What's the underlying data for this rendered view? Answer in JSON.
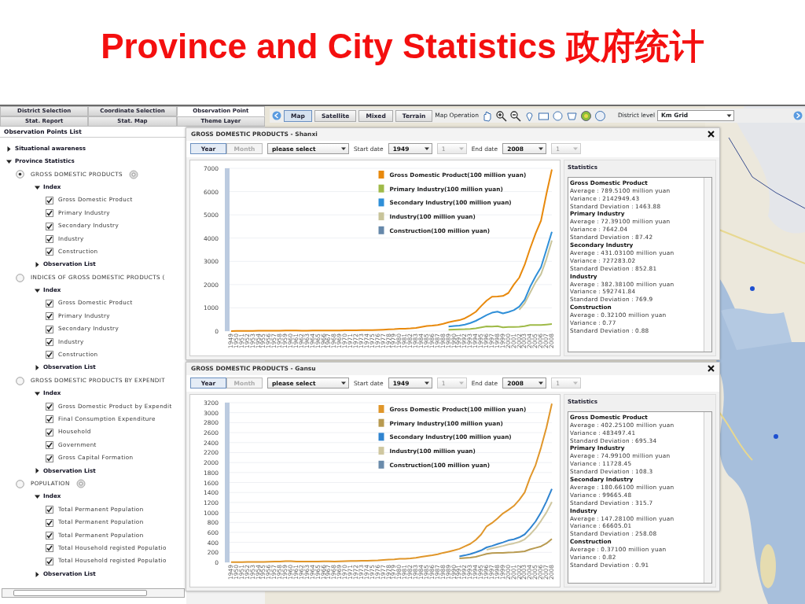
{
  "title": "Province and City Statistics 政府统计",
  "left_tabs": [
    [
      {
        "label": "District Selection",
        "selected": false
      },
      {
        "label": "Coordinate Selection",
        "selected": false
      },
      {
        "label": "Observation Point",
        "selected": true
      }
    ],
    [
      {
        "label": "Stat. Report",
        "selected": false
      },
      {
        "label": "Stat. Map",
        "selected": false
      },
      {
        "label": "Theme Layer",
        "selected": false
      }
    ]
  ],
  "list_title": "Observation Points List",
  "tree": [
    {
      "kind": "folder",
      "label": "Situational awareness",
      "expanded": false
    },
    {
      "kind": "folder",
      "label": "Province Statistics",
      "expanded": true,
      "children": [
        {
          "kind": "radio",
          "label": "GROSS DOMESTIC PRODUCTS",
          "selected": true,
          "has_settings": true,
          "children": [
            {
              "kind": "folder",
              "label": "Index",
              "expanded": true,
              "children": [
                {
                  "kind": "checkbox",
                  "label": "Gross Domestic Product",
                  "checked": true
                },
                {
                  "kind": "checkbox",
                  "label": "Primary Industry",
                  "checked": true
                },
                {
                  "kind": "checkbox",
                  "label": "Secondary Industry",
                  "checked": true
                },
                {
                  "kind": "checkbox",
                  "label": "Industry",
                  "checked": true
                },
                {
                  "kind": "checkbox",
                  "label": "Construction",
                  "checked": true
                }
              ]
            },
            {
              "kind": "folder",
              "label": "Observation List",
              "expanded": false
            }
          ]
        },
        {
          "kind": "radio",
          "label": "INDICES OF GROSS DOMESTIC PRODUCTS (",
          "selected": false,
          "has_settings": false,
          "children": [
            {
              "kind": "folder",
              "label": "Index",
              "expanded": true,
              "children": [
                {
                  "kind": "checkbox",
                  "label": "Gross Domestic Product",
                  "checked": true
                },
                {
                  "kind": "checkbox",
                  "label": "Primary Industry",
                  "checked": true
                },
                {
                  "kind": "checkbox",
                  "label": "Secondary Industry",
                  "checked": true
                },
                {
                  "kind": "checkbox",
                  "label": "Industry",
                  "checked": true
                },
                {
                  "kind": "checkbox",
                  "label": "Construction",
                  "checked": true
                }
              ]
            },
            {
              "kind": "folder",
              "label": "Observation List",
              "expanded": false
            }
          ]
        },
        {
          "kind": "radio",
          "label": "GROSS DOMESTIC PRODUCTS BY EXPENDIT",
          "selected": false,
          "has_settings": false,
          "children": [
            {
              "kind": "folder",
              "label": "Index",
              "expanded": true,
              "children": [
                {
                  "kind": "checkbox",
                  "label": "Gross Domestic Product by Expendit",
                  "checked": true
                },
                {
                  "kind": "checkbox",
                  "label": "Final Consumption Expenditure",
                  "checked": true
                },
                {
                  "kind": "checkbox",
                  "label": "Household",
                  "checked": true
                },
                {
                  "kind": "checkbox",
                  "label": "Government",
                  "checked": true
                },
                {
                  "kind": "checkbox",
                  "label": "Gross Capital Formation",
                  "checked": true
                }
              ]
            },
            {
              "kind": "folder",
              "label": "Observation List",
              "expanded": false
            }
          ]
        },
        {
          "kind": "radio",
          "label": "POPULATION",
          "selected": false,
          "has_settings": true,
          "children": [
            {
              "kind": "folder",
              "label": "Index",
              "expanded": true,
              "children": [
                {
                  "kind": "checkbox",
                  "label": "Total Permanent Population",
                  "checked": true
                },
                {
                  "kind": "checkbox",
                  "label": "Total Permanent Population",
                  "checked": true
                },
                {
                  "kind": "checkbox",
                  "label": "Total Permanent Population",
                  "checked": true
                },
                {
                  "kind": "checkbox",
                  "label": "Total Household registed Populatio",
                  "checked": true
                },
                {
                  "kind": "checkbox",
                  "label": "Total Household registed Populatio",
                  "checked": true
                }
              ]
            },
            {
              "kind": "folder",
              "label": "Observation List",
              "expanded": false
            }
          ]
        }
      ]
    }
  ],
  "map_toolbar": {
    "map_types": [
      {
        "label": "Map",
        "selected": true
      },
      {
        "label": "Satellite",
        "selected": false
      },
      {
        "label": "Mixed",
        "selected": false
      },
      {
        "label": "Terrain",
        "selected": false
      }
    ],
    "operation_label": "Map Operation",
    "district_label": "District level",
    "district_value": "Km Grid"
  },
  "chart_windows": [
    {
      "title": "GROSS DOMESTIC PRODUCTS - Shanxi",
      "modes": [
        {
          "label": "Year",
          "selected": true
        },
        {
          "label": "Month",
          "selected": false
        }
      ],
      "category_select": "please select",
      "start_label": "Start date",
      "start_year": "1949",
      "start_month": {
        "value": "1",
        "disabled": true
      },
      "end_label": "End date",
      "end_year": "2008",
      "end_month": {
        "value": "1",
        "disabled": true
      },
      "chart_data": {
        "type": "line",
        "categories": [
          "1949",
          "1950",
          "1951",
          "1952",
          "1953",
          "1954",
          "1955",
          "1956",
          "1957",
          "1958",
          "1959",
          "1960",
          "1961",
          "1962",
          "1963",
          "1964",
          "1965",
          "1966",
          "1967",
          "1968",
          "1969",
          "1970",
          "1971",
          "1972",
          "1973",
          "1974",
          "1975",
          "1976",
          "1977",
          "1978",
          "1979",
          "1980",
          "1981",
          "1982",
          "1983",
          "1984",
          "1985",
          "1986",
          "1987",
          "1988",
          "1989",
          "1990",
          "1991",
          "1992",
          "1993",
          "1994",
          "1995",
          "1996",
          "1997",
          "1998",
          "1999",
          "2000",
          "2001",
          "2002",
          "2003",
          "2004",
          "2005",
          "2006",
          "2007",
          "2008"
        ],
        "series": [
          {
            "name": "Gross Domestic Product(100 million yuan)",
            "color": "#e8890c",
            "values": [
              5,
              6,
              8,
              9,
              10,
              12,
              13,
              15,
              17,
              20,
              24,
              26,
              22,
              20,
              20,
              22,
              25,
              28,
              26,
              25,
              28,
              32,
              36,
              38,
              40,
              42,
              45,
              50,
              60,
              75,
              85,
              100,
              105,
              120,
              140,
              180,
              220,
              235,
              260,
              315,
              380,
              430,
              470,
              550,
              680,
              830,
              1080,
              1310,
              1480,
              1490,
              1510,
              1640,
              2000,
              2300,
              2850,
              3550,
              4200,
              4750,
              5900,
              6950
            ]
          },
          {
            "name": "Primary Industry(100 million yuan)",
            "color": "#9fba48",
            "values": [
              null,
              null,
              null,
              null,
              null,
              null,
              null,
              null,
              null,
              null,
              null,
              null,
              null,
              null,
              null,
              null,
              null,
              null,
              null,
              null,
              null,
              null,
              null,
              null,
              null,
              null,
              null,
              null,
              null,
              null,
              null,
              null,
              null,
              null,
              null,
              null,
              null,
              null,
              null,
              null,
              60,
              70,
              75,
              80,
              95,
              120,
              160,
              200,
              195,
              210,
              160,
              180,
              175,
              190,
              210,
              265,
              260,
              265,
              280,
              300
            ]
          },
          {
            "name": "Secondary Industry(100 million yuan)",
            "color": "#2f8fd8",
            "values": [
              null,
              null,
              null,
              null,
              null,
              null,
              null,
              null,
              null,
              null,
              null,
              null,
              null,
              null,
              null,
              null,
              null,
              null,
              null,
              null,
              null,
              null,
              null,
              null,
              null,
              null,
              null,
              null,
              null,
              null,
              null,
              null,
              null,
              null,
              null,
              null,
              null,
              null,
              null,
              null,
              195,
              220,
              240,
              280,
              350,
              440,
              560,
              690,
              790,
              840,
              760,
              820,
              900,
              1050,
              1350,
              1900,
              2350,
              2750,
              3500,
              4270
            ]
          },
          {
            "name": "Industry(100 million yuan)",
            "color": "#c8c49a",
            "values": [
              null,
              null,
              null,
              null,
              null,
              null,
              null,
              null,
              null,
              null,
              null,
              null,
              null,
              null,
              null,
              null,
              null,
              null,
              null,
              null,
              null,
              null,
              null,
              null,
              null,
              null,
              null,
              null,
              null,
              null,
              null,
              null,
              null,
              null,
              null,
              null,
              null,
              null,
              null,
              null,
              null,
              null,
              null,
              null,
              null,
              null,
              null,
              null,
              null,
              null,
              null,
              null,
              null,
              920,
              1200,
              1650,
              2100,
              2450,
              3100,
              3900
            ]
          },
          {
            "name": "Construction(100 million yuan)",
            "color": "#6688aa",
            "values": [
              null,
              null,
              null,
              null,
              null,
              null,
              null,
              null,
              null,
              null,
              null,
              null,
              null,
              null,
              null,
              null,
              null,
              null,
              null,
              null,
              null,
              null,
              null,
              null,
              null,
              null,
              null,
              null,
              null,
              null,
              null,
              null,
              null,
              null,
              null,
              null,
              null,
              null,
              null,
              null,
              null,
              null,
              null,
              null,
              null,
              null,
              null,
              null,
              null,
              null,
              null,
              null,
              null,
              null,
              null,
              null,
              null,
              null,
              null,
              null
            ]
          }
        ],
        "grid": true,
        "legend": true,
        "ylim": [
          0,
          7000
        ],
        "yticks": [
          0,
          1000,
          2000,
          3000,
          4000,
          5000,
          6000,
          7000
        ]
      },
      "stats_title": "Statistics",
      "stats": [
        {
          "heading": "Gross Domestic Product",
          "lines": [
            "Average：789.5100 million yuan",
            "Variance：2142949.43",
            "Standard Deviation：1463.88"
          ]
        },
        {
          "heading": "Primary Industry",
          "lines": [
            "Average：72.39100 million yuan",
            "Variance：7642.04",
            "Standard Deviation：87.42"
          ]
        },
        {
          "heading": "Secondary Industry",
          "lines": [
            "Average：431.03100 million yuan",
            "Variance：727283.02",
            "Standard Deviation：852.81"
          ]
        },
        {
          "heading": "Industry",
          "lines": [
            "Average：382.38100 million yuan",
            "Variance：592741.84",
            "Standard Deviation：769.9"
          ]
        },
        {
          "heading": "Construction",
          "lines": [
            "Average：0.32100 million yuan",
            "Variance：0.77",
            "Standard Deviation：0.88"
          ]
        }
      ]
    },
    {
      "title": "GROSS DOMESTIC PRODUCTS - Gansu",
      "modes": [
        {
          "label": "Year",
          "selected": true
        },
        {
          "label": "Month",
          "selected": false
        }
      ],
      "category_select": "please select",
      "start_label": "Start date",
      "start_year": "1949",
      "start_month": {
        "value": "1",
        "disabled": true
      },
      "end_label": "End date",
      "end_year": "2008",
      "end_month": {
        "value": "1",
        "disabled": true
      },
      "chart_data": {
        "type": "line",
        "categories": [
          "1949",
          "1950",
          "1951",
          "1952",
          "1953",
          "1954",
          "1955",
          "1956",
          "1957",
          "1958",
          "1959",
          "1960",
          "1961",
          "1962",
          "1963",
          "1964",
          "1965",
          "1966",
          "1967",
          "1968",
          "1969",
          "1970",
          "1971",
          "1972",
          "1973",
          "1974",
          "1975",
          "1976",
          "1977",
          "1978",
          "1979",
          "1980",
          "1981",
          "1982",
          "1983",
          "1984",
          "1985",
          "1986",
          "1987",
          "1988",
          "1989",
          "1990",
          "1991",
          "1992",
          "1993",
          "1994",
          "1995",
          "1996",
          "1997",
          "1998",
          "1999",
          "2000",
          "2001",
          "2002",
          "2003",
          "2004",
          "2005",
          "2006",
          "2007",
          "2008"
        ],
        "series": [
          {
            "name": "Gross Domestic Product(100 million yuan)",
            "color": "#e0962a",
            "values": [
              3,
              4,
              5,
              6,
              8,
              9,
              10,
              12,
              14,
              18,
              22,
              24,
              18,
              15,
              14,
              15,
              17,
              20,
              19,
              18,
              20,
              24,
              27,
              28,
              30,
              32,
              34,
              38,
              45,
              55,
              60,
              70,
              72,
              78,
              90,
              110,
              125,
              140,
              160,
              190,
              215,
              240,
              270,
              320,
              370,
              450,
              560,
              720,
              790,
              880,
              980,
              1050,
              1130,
              1250,
              1400,
              1700,
              1950,
              2300,
              2700,
              3180
            ]
          },
          {
            "name": "Primary Industry(100 million yuan)",
            "color": "#b89a50",
            "values": [
              null,
              null,
              null,
              null,
              null,
              null,
              null,
              null,
              null,
              null,
              null,
              null,
              null,
              null,
              null,
              null,
              null,
              null,
              null,
              null,
              null,
              null,
              null,
              null,
              null,
              null,
              null,
              null,
              null,
              null,
              null,
              null,
              null,
              null,
              null,
              null,
              null,
              null,
              null,
              null,
              null,
              null,
              78,
              85,
              95,
              110,
              140,
              170,
              185,
              190,
              190,
              195,
              200,
              210,
              220,
              260,
              290,
              320,
              380,
              470
            ]
          },
          {
            "name": "Secondary Industry(100 million yuan)",
            "color": "#2f84d0",
            "values": [
              null,
              null,
              null,
              null,
              null,
              null,
              null,
              null,
              null,
              null,
              null,
              null,
              null,
              null,
              null,
              null,
              null,
              null,
              null,
              null,
              null,
              null,
              null,
              null,
              null,
              null,
              null,
              null,
              null,
              null,
              null,
              null,
              null,
              null,
              null,
              null,
              null,
              null,
              null,
              null,
              null,
              null,
              120,
              140,
              165,
              200,
              240,
              300,
              330,
              365,
              400,
              440,
              460,
              500,
              560,
              680,
              820,
              1000,
              1220,
              1470
            ]
          },
          {
            "name": "Industry(100 million yuan)",
            "color": "#cfc7a0",
            "values": [
              null,
              null,
              null,
              null,
              null,
              null,
              null,
              null,
              null,
              null,
              null,
              null,
              null,
              null,
              null,
              null,
              null,
              null,
              null,
              null,
              null,
              null,
              null,
              null,
              null,
              null,
              null,
              null,
              null,
              null,
              null,
              null,
              null,
              null,
              null,
              null,
              null,
              null,
              null,
              null,
              null,
              null,
              null,
              null,
              null,
              null,
              null,
              250,
              280,
              305,
              330,
              360,
              380,
              410,
              460,
              560,
              680,
              830,
              1000,
              1210
            ]
          },
          {
            "name": "Construction(100 million yuan)",
            "color": "#6a8bab",
            "values": [
              null,
              null,
              null,
              null,
              null,
              null,
              null,
              null,
              null,
              null,
              null,
              null,
              null,
              null,
              null,
              null,
              null,
              null,
              null,
              null,
              null,
              null,
              null,
              null,
              null,
              null,
              null,
              null,
              null,
              null,
              null,
              null,
              null,
              null,
              null,
              null,
              null,
              null,
              null,
              null,
              null,
              null,
              null,
              null,
              null,
              null,
              null,
              null,
              null,
              null,
              null,
              null,
              null,
              null,
              null,
              null,
              null,
              null,
              null,
              null
            ]
          }
        ],
        "grid": true,
        "legend": true,
        "ylim": [
          0,
          3200
        ],
        "yticks": [
          0,
          200,
          400,
          600,
          800,
          1000,
          1200,
          1400,
          1600,
          1800,
          2000,
          2200,
          2400,
          2600,
          2800,
          3000,
          3200
        ]
      },
      "stats_title": "Statistics",
      "stats": [
        {
          "heading": "Gross Domestic Product",
          "lines": [
            "Average：402.25100 million yuan",
            "Variance：483497.41",
            "Standard Deviation：695.34"
          ]
        },
        {
          "heading": "Primary Industry",
          "lines": [
            "Average：74.99100 million yuan",
            "Variance：11728.45",
            "Standard Deviation：108.3"
          ]
        },
        {
          "heading": "Secondary Industry",
          "lines": [
            "Average：180.66100 million yuan",
            "Variance：99665.48",
            "Standard Deviation：315.7"
          ]
        },
        {
          "heading": "Industry",
          "lines": [
            "Average：147.28100 million yuan",
            "Variance：66605.01",
            "Standard Deviation：258.08"
          ]
        },
        {
          "heading": "Construction",
          "lines": [
            "Average：0.37100 million yuan",
            "Variance：0.82",
            "Standard Deviation：0.91"
          ]
        }
      ]
    }
  ]
}
